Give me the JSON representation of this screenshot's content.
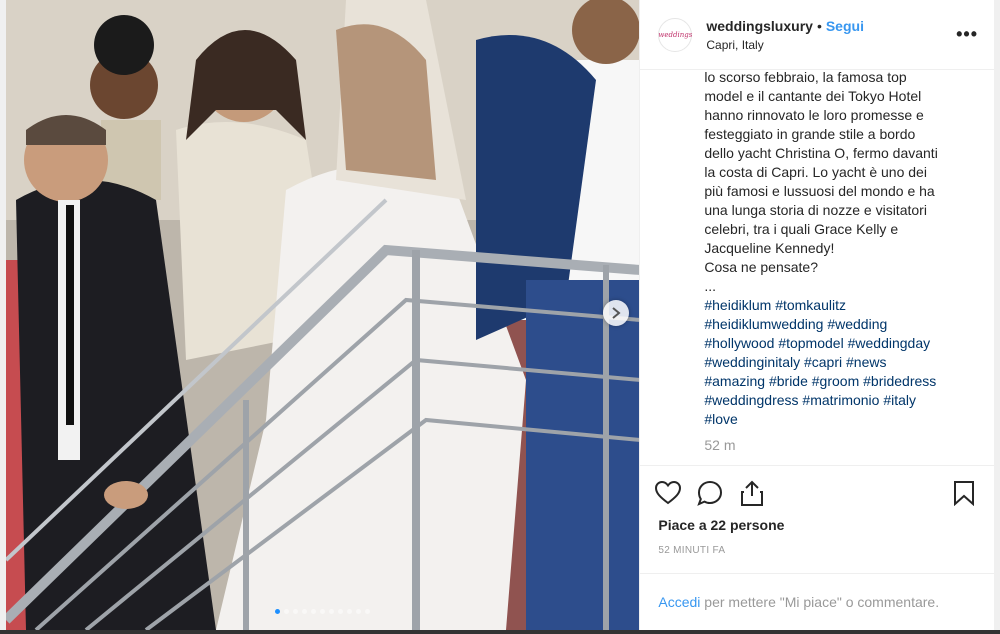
{
  "post": {
    "username": "weddingsluxury",
    "separator": "•",
    "follow_label": "Segui",
    "location": "Capri, Italy",
    "more_icon": "•••",
    "avatar_text": "weddings"
  },
  "caption": {
    "text": "lo scorso febbraio, la famosa top\nmodel e il cantante dei Tokyo Hotel\nhanno rinnovato le loro promesse e\nfesteggiato in grande stile a bordo\ndello yacht Christina O, fermo davanti\nla costa di Capri. Lo yacht è uno dei\npiù famosi e lussuosi del mondo e ha\nuna lunga storia di nozze e visitatori\ncelebri, tra i quali Grace Kelly e\nJacqueline Kennedy!\nCosa ne pensate?\n...",
    "hashtag_lines": [
      [
        "#heidiklum",
        "#tomkaulitz"
      ],
      [
        "#heidiklumwedding",
        "#wedding"
      ],
      [
        "#hollywood",
        "#topmodel",
        "#weddingday"
      ],
      [
        "#weddinginitaly",
        "#capri",
        "#news"
      ],
      [
        "#amazing",
        "#bride",
        "#groom",
        "#bridedress"
      ],
      [
        "#weddingdress",
        "#matrimonio",
        "#italy"
      ],
      [
        "#love"
      ]
    ],
    "time_ago": "52 m"
  },
  "actions": {
    "like_icon": "heart-icon",
    "comment_icon": "comment-icon",
    "share_icon": "share-icon",
    "save_icon": "bookmark-icon"
  },
  "likes_text": "Piace a 22 persone",
  "posted_ago": "52 MINUTI FA",
  "comment_bar": {
    "login_link": "Accedi",
    "text": " per mettere \"Mi piace\" o commentare."
  },
  "carousel": {
    "dot_count": 11,
    "active_index": 0
  },
  "colors": {
    "link_blue": "#3897f0",
    "hashtag": "#003569",
    "text": "#262626",
    "muted": "#999999"
  }
}
